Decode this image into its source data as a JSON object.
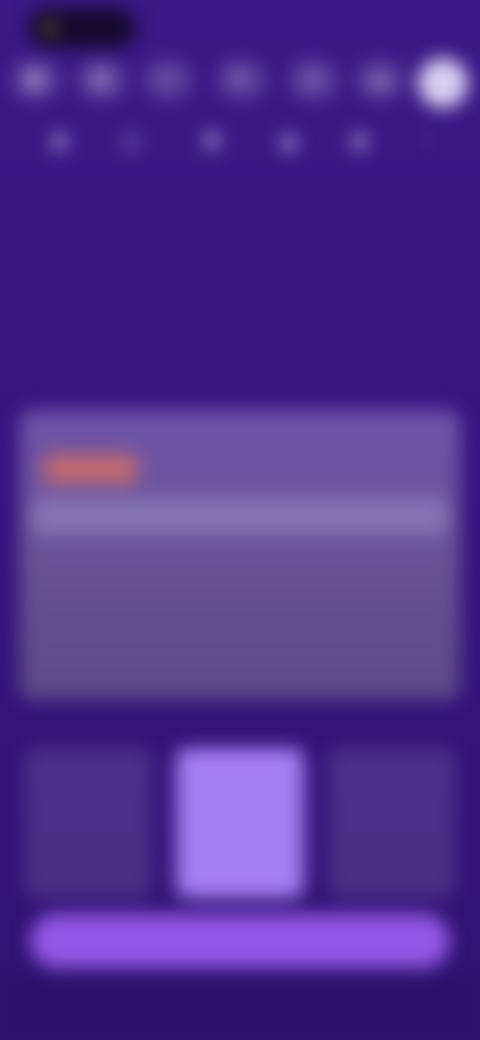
{
  "status": {
    "left_label": "",
    "right_label": ""
  },
  "shortcuts": [
    {
      "icon": "grid-icon",
      "glyph": "▦"
    },
    {
      "icon": "chart-icon",
      "glyph": "▤"
    },
    {
      "icon": "star-icon",
      "glyph": "☆"
    },
    {
      "icon": "edit-icon",
      "glyph": "✎"
    },
    {
      "icon": "folder-icon",
      "glyph": "▢"
    },
    {
      "icon": "cloud-icon",
      "glyph": "☁"
    }
  ],
  "tools": [
    {
      "icon": "tool-icon-1",
      "glyph": "◧",
      "label": ""
    },
    {
      "icon": "tool-icon-2",
      "glyph": "◫",
      "label": ""
    },
    {
      "icon": "tool-icon-3",
      "glyph": "◩",
      "label": ""
    },
    {
      "icon": "tool-icon-4",
      "glyph": "◪",
      "label": ""
    },
    {
      "icon": "tool-icon-5",
      "glyph": "◨",
      "label": ""
    },
    {
      "icon": "tool-icon-6",
      "glyph": "◦",
      "label": ""
    }
  ],
  "header": {
    "caption": "",
    "title": "",
    "price": ""
  },
  "card": {
    "small_text": "",
    "tag": "",
    "band_text": ""
  },
  "plans": [
    {
      "title": "",
      "price": "",
      "note": "",
      "selected": false
    },
    {
      "title": "",
      "price": "",
      "note": "",
      "selected": true
    },
    {
      "title": "",
      "price": "",
      "note": "",
      "selected": false
    }
  ],
  "cta": {
    "label": ""
  },
  "colors": {
    "background": "#3a1a86",
    "card": "#6a559a",
    "tag": "#c06a6f",
    "selected_plan": "#a57df2",
    "cta": "#9458e6"
  }
}
